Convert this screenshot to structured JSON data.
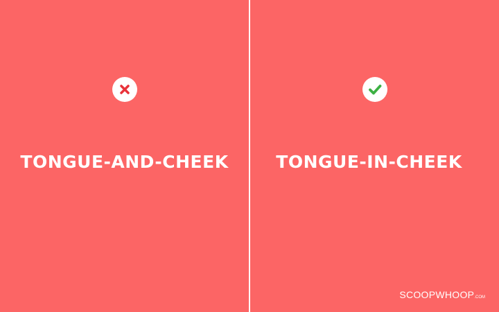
{
  "background_color": "#fc6565",
  "divider_color": "#ffffff",
  "left_panel": {
    "icon": "cross-icon",
    "icon_color": "#e8323a",
    "phrase": "TONGUE-AND-CHEEK"
  },
  "right_panel": {
    "icon": "checkmark-icon",
    "icon_color": "#3cb043",
    "phrase": "TONGUE-IN-CHEEK"
  },
  "watermark": {
    "name": "SCOOPWHOOP",
    "suffix": ".COM"
  }
}
